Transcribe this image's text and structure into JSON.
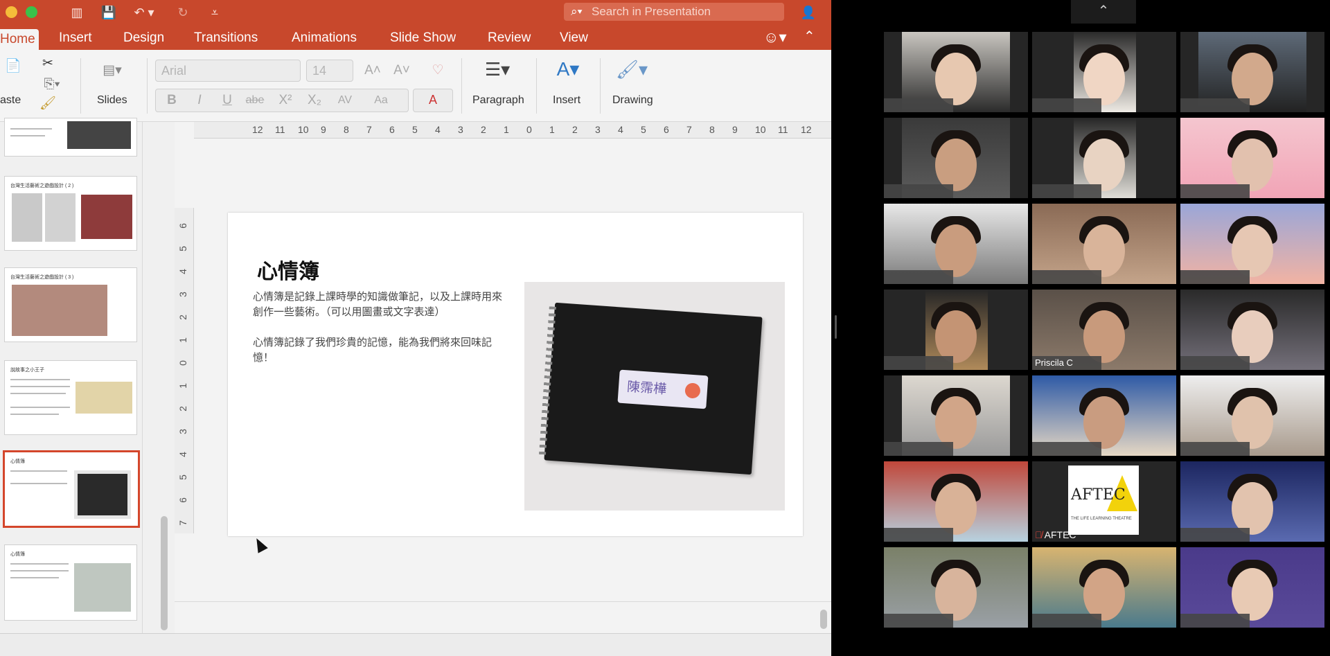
{
  "ppt": {
    "search_placeholder": "Search in Presentation",
    "tabs": [
      "Home",
      "Insert",
      "Design",
      "Transitions",
      "Animations",
      "Slide Show",
      "Review",
      "View"
    ],
    "ribbon": {
      "paste_label": "aste",
      "slides_label": "Slides",
      "font_name": "Arial",
      "font_size": "14",
      "paragraph_label": "Paragraph",
      "insert_label": "Insert",
      "drawing_label": "Drawing",
      "format_buttons": [
        "B",
        "I",
        "U",
        "abe",
        "X²",
        "X₂",
        "AV",
        "Aa",
        "A"
      ]
    },
    "ruler_h": [
      "12",
      "11",
      "10",
      "9",
      "8",
      "7",
      "6",
      "5",
      "4",
      "3",
      "2",
      "1",
      "0",
      "1",
      "2",
      "3",
      "4",
      "5",
      "6",
      "7",
      "8",
      "9",
      "10",
      "11",
      "12"
    ],
    "ruler_v": [
      "6",
      "5",
      "4",
      "3",
      "2",
      "1",
      "0",
      "1",
      "2",
      "3",
      "4",
      "5",
      "6",
      "7"
    ],
    "thumbnails": [
      {
        "title": ""
      },
      {
        "title": "台灣生活藝術之遊戲設計 ( 2 )"
      },
      {
        "title": "台灣生活藝術之遊戲設計 ( 3 )"
      },
      {
        "title": "說故事之小王子"
      },
      {
        "title": "心情簿"
      },
      {
        "title": "心情簿"
      }
    ],
    "slide": {
      "title": "心情簿",
      "paragraph1": "心情簿是記錄上課時學的知識做筆記，以及上課時用來創作一些藝術。（可以用圖畫或文字表達）",
      "paragraph2": "心情簿記錄了我們珍貴的記憶，能為我們將來回味記憶！",
      "label_text": "陳霈樺"
    }
  },
  "zoom": {
    "names": {
      "priscila": "Priscila C",
      "aftec": "AFTEC"
    },
    "aftec_logo": "AFTEC",
    "aftec_sub": "THE LIFE LEARNING THEATRE"
  },
  "colors": {
    "accent": "#c8482c",
    "active_thumb": "#d4462b"
  }
}
